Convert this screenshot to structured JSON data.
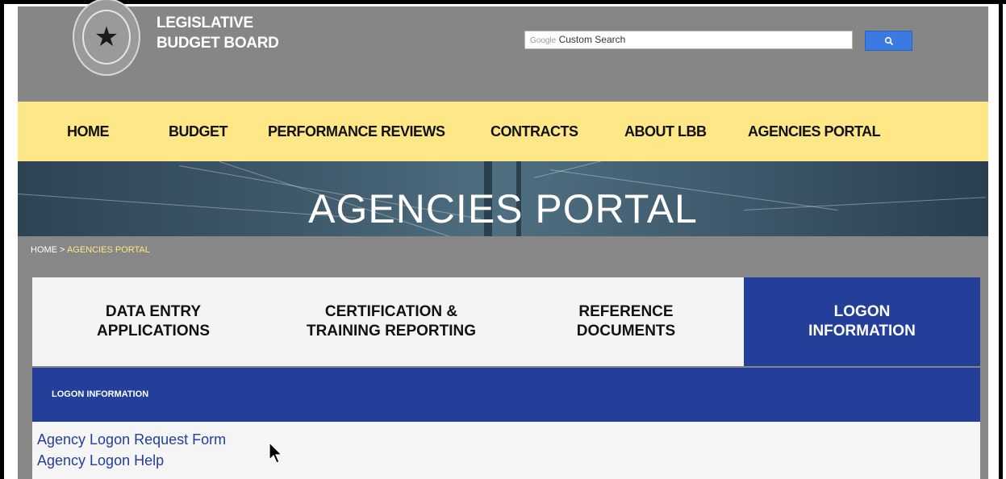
{
  "header": {
    "brand_line1": "LEGISLATIVE",
    "brand_line2": "BUDGET BOARD",
    "search_brand": "Google",
    "search_placeholder": "Custom Search",
    "search_button_icon": "magnifier-icon",
    "seal_icon": "star-seal-icon"
  },
  "nav": {
    "items": [
      {
        "label": "HOME"
      },
      {
        "label": "BUDGET"
      },
      {
        "label": "PERFORMANCE REVIEWS"
      },
      {
        "label": "CONTRACTS"
      },
      {
        "label": "ABOUT LBB"
      },
      {
        "label": "AGENCIES PORTAL"
      }
    ]
  },
  "hero": {
    "title": "AGENCIES PORTAL"
  },
  "breadcrumb": {
    "home": "HOME",
    "separator": " > ",
    "current": "AGENCIES PORTAL"
  },
  "tabs": [
    {
      "line1": "DATA ENTRY",
      "line2": "APPLICATIONS",
      "active": false
    },
    {
      "line1": "CERTIFICATION &",
      "line2": "TRAINING REPORTING",
      "active": false
    },
    {
      "line1": "REFERENCE",
      "line2": "DOCUMENTS",
      "active": false
    },
    {
      "line1": "LOGON",
      "line2": "INFORMATION",
      "active": true
    }
  ],
  "section": {
    "title": "LOGON INFORMATION",
    "links": [
      {
        "label": "Agency Logon Request Form"
      },
      {
        "label": "Agency Logon Help"
      }
    ]
  },
  "colors": {
    "header_gray": "#868686",
    "nav_yellow": "#fde787",
    "accent_blue": "#233f99",
    "breadcrumb_current": "#fde787",
    "search_button": "#3b7ae0"
  }
}
